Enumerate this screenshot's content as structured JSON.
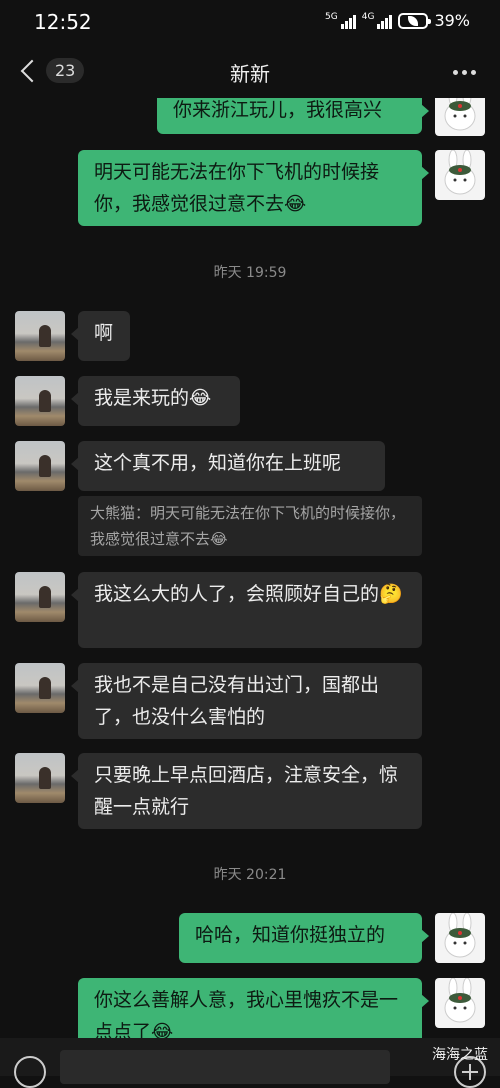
{
  "status": {
    "time": "12:52",
    "net1": "5G",
    "net2": "4G",
    "battery": "39%"
  },
  "nav": {
    "back_count": "23",
    "title": "新新"
  },
  "messages": {
    "m0": "你来浙江玩儿，我很高兴",
    "m1": "明天可能无法在你下飞机的时候接你，我感觉很过意不去😂",
    "t1": "昨天 19:59",
    "o1": "啊",
    "o2": "我是来玩的😂",
    "o3": "这个真不用，知道你在上班呢",
    "q1": "大熊猫：明天可能无法在你下飞机的时候接你，我感觉很过意不去😂",
    "o4": "我这么大的人了，会照顾好自己的🤔",
    "o5": "我也不是自己没有出过门，国都出了，也没什么害怕的",
    "o6": "只要晚上早点回酒店，注意安全，惊醒一点就行",
    "t2": "昨天 20:21",
    "m2": "哈哈，知道你挺独立的",
    "m3": "你这么善解人意，我心里愧疚不是一点点了😂"
  },
  "watermark": "海海之蓝",
  "icons": {
    "back": "back-chevron-icon",
    "more": "more-dots-icon",
    "voice": "voice-icon",
    "plus": "plus-icon"
  }
}
